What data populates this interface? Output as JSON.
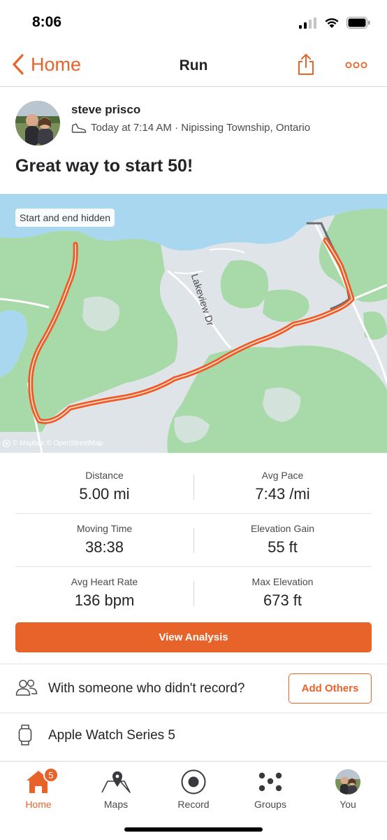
{
  "status_bar": {
    "time": "8:06"
  },
  "nav": {
    "back_label": "Home",
    "title": "Run"
  },
  "activity": {
    "athlete_name": "steve prisco",
    "meta": "Today at 7:14 AM · Nipissing Township, Ontario",
    "title": "Great way to start 50!"
  },
  "map": {
    "privacy_label": "Start and end hidden",
    "street_label": "Lakeview Dr",
    "attribution": "© Mapbox © OpenStreetMap",
    "route_color": "#f05a22",
    "hidden_color": "#6b6b70"
  },
  "stats": [
    {
      "label": "Distance",
      "value": "5.00 mi"
    },
    {
      "label": "Avg Pace",
      "value": "7:43 /mi"
    },
    {
      "label": "Moving Time",
      "value": "38:38"
    },
    {
      "label": "Elevation Gain",
      "value": "55 ft"
    },
    {
      "label": "Avg Heart Rate",
      "value": "136 bpm"
    },
    {
      "label": "Max Elevation",
      "value": "673 ft"
    }
  ],
  "actions": {
    "view_analysis": "View Analysis",
    "others_prompt": "With someone who didn't record?",
    "add_others": "Add Others",
    "device": "Apple Watch Series 5"
  },
  "tabs": [
    {
      "label": "Home",
      "icon": "home-icon",
      "badge": "5"
    },
    {
      "label": "Maps",
      "icon": "map-icon"
    },
    {
      "label": "Record",
      "icon": "record-icon"
    },
    {
      "label": "Groups",
      "icon": "groups-icon"
    },
    {
      "label": "You",
      "icon": "avatar"
    }
  ],
  "colors": {
    "accent": "#e8632a",
    "text": "#242428",
    "water": "#a9d7f0",
    "forest": "#a8d9a8"
  }
}
